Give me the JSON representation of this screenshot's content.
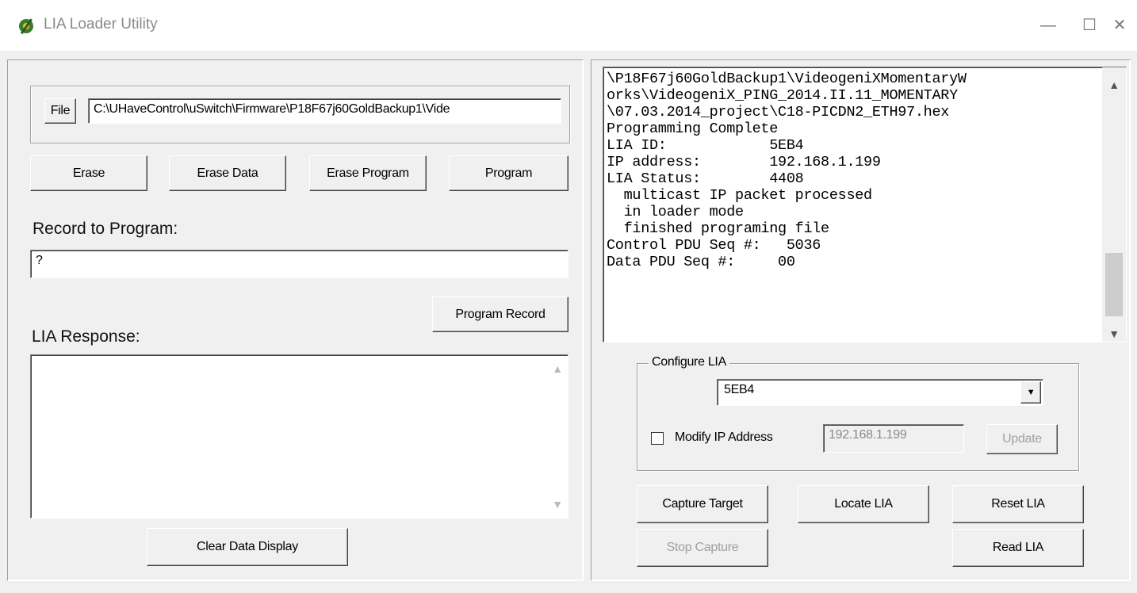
{
  "window": {
    "title": "LIA Loader Utility",
    "minimize_glyph": "—",
    "maximize_glyph": "☐",
    "close_glyph": "✕"
  },
  "left": {
    "file_button": "File",
    "file_path": "C:\\UHaveControl\\uSwitch\\Firmware\\P18F67j60GoldBackup1\\Vide",
    "erase": "Erase",
    "erase_data": "Erase Data",
    "erase_program": "Erase Program",
    "program": "Program",
    "record_label": "Record to Program:",
    "record_value": "?",
    "program_record": "Program Record",
    "response_label": "LIA Response:",
    "response_text": "",
    "clear_display": "Clear Data Display"
  },
  "right": {
    "log_lines": [
      "\\P18F67j60GoldBackup1\\VideogeniXMomentaryW",
      "orks\\VideogeniX_PING_2014.II.11_MOMENTARY",
      "\\07.03.2014_project\\C18-PICDN2_ETH97.hex",
      "Programming Complete",
      "LIA ID:            5EB4",
      "IP address:        192.168.1.199",
      "LIA Status:        4408",
      "  multicast IP packet processed",
      "  in loader mode",
      "  finished programing file",
      "Control PDU Seq #:   5036",
      "Data PDU Seq #:     00"
    ],
    "configure_label": "Configure LIA",
    "lia_selected": "5EB4",
    "modify_ip_label": "Modify IP Address",
    "modify_ip_checked": false,
    "ip_value": "192.168.1.199",
    "update": "Update",
    "capture_target": "Capture Target",
    "locate_lia": "Locate LIA",
    "reset_lia": "Reset LIA",
    "stop_capture": "Stop Capture",
    "read_lia": "Read LIA"
  },
  "icons": {
    "app": "wrench-gear-icon",
    "scroll_up": "▲",
    "scroll_down": "▼",
    "dropdown": "▼"
  }
}
